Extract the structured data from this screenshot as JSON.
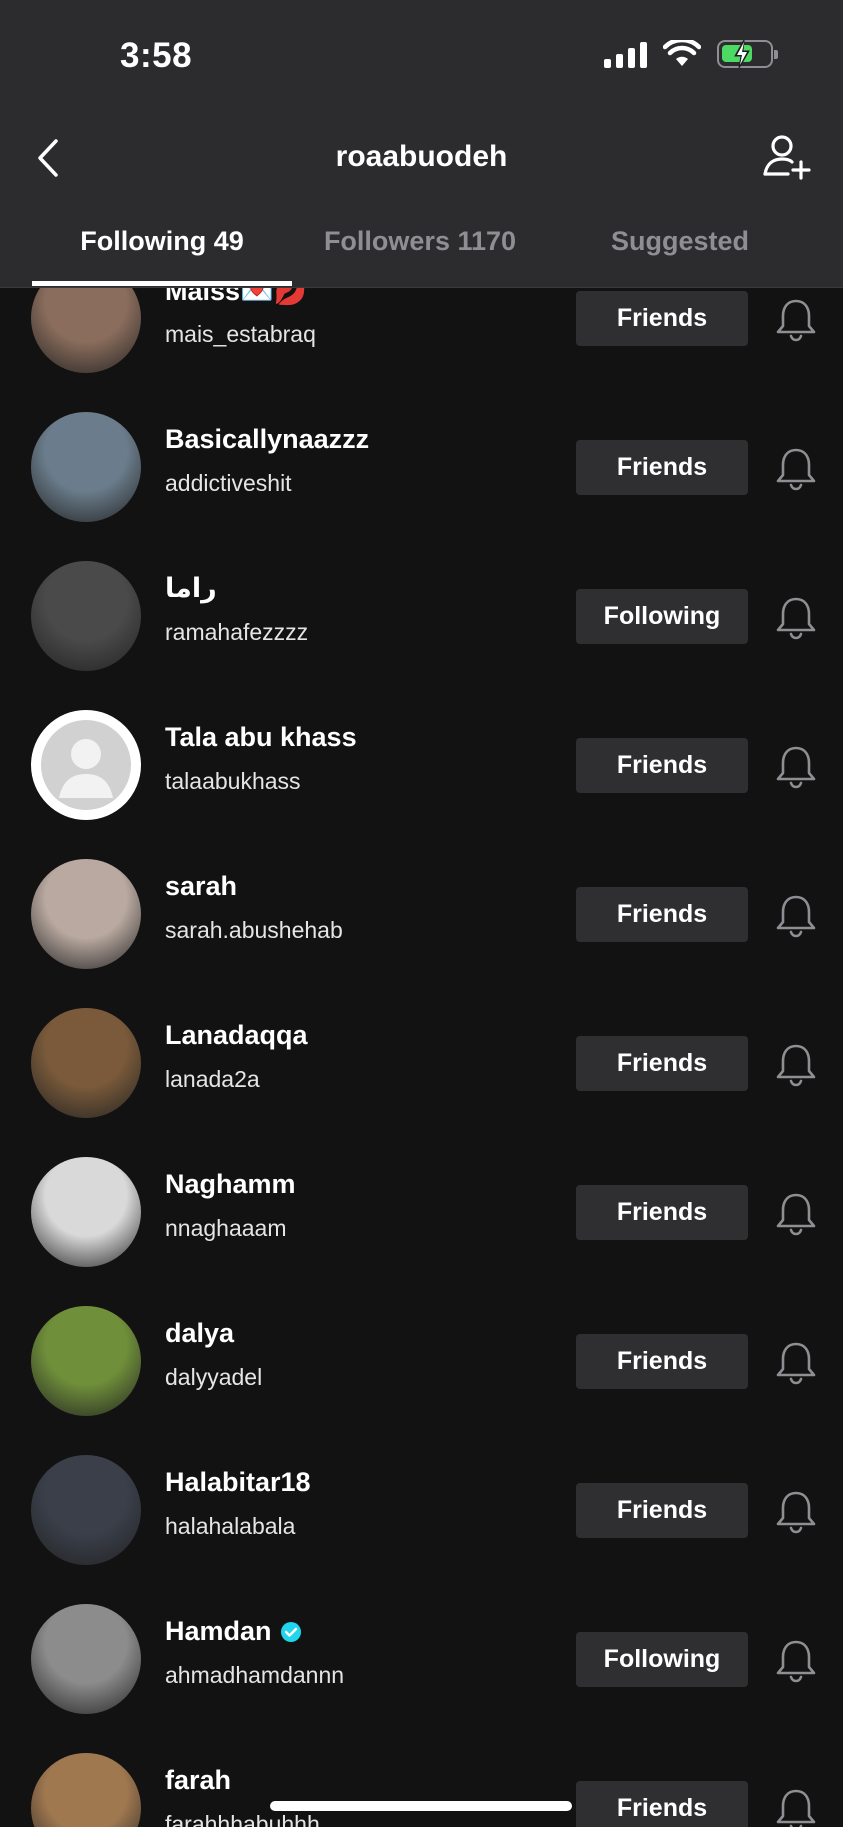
{
  "status_bar": {
    "time": "3:58"
  },
  "header": {
    "title": "roaabuodeh"
  },
  "tabs": [
    {
      "label": "Following 49",
      "active": true
    },
    {
      "label": "Followers 1170",
      "active": false
    },
    {
      "label": "Suggested",
      "active": false
    }
  ],
  "users": [
    {
      "name": "Maiss💌💋",
      "handle": "mais_estabraq",
      "action": "Friends",
      "verified": false,
      "avatar_color": "#8a6d5c"
    },
    {
      "name": "Basicallynaazzz",
      "handle": "addictiveshit",
      "action": "Friends",
      "verified": false,
      "avatar_color": "#6b7d8c"
    },
    {
      "name": "راما",
      "handle": "ramahafezzzz",
      "action": "Following",
      "verified": false,
      "avatar_color": "#4a4a4a"
    },
    {
      "name": "Tala abu khass",
      "handle": "talaabukhass",
      "action": "Friends",
      "verified": false,
      "avatar_color": "#cfcfcf"
    },
    {
      "name": "sarah",
      "handle": "sarah.abushehab",
      "action": "Friends",
      "verified": false,
      "avatar_color": "#b9a9a0"
    },
    {
      "name": "Lanadaqqa",
      "handle": "lanada2a",
      "action": "Friends",
      "verified": false,
      "avatar_color": "#7a5a3a"
    },
    {
      "name": "Naghamm",
      "handle": "nnaghaaam",
      "action": "Friends",
      "verified": false,
      "avatar_color": "#d9d9d9"
    },
    {
      "name": "dalya",
      "handle": "dalyyadel",
      "action": "Friends",
      "verified": false,
      "avatar_color": "#6f8f3a"
    },
    {
      "name": "Halabitar18",
      "handle": "halahalabala",
      "action": "Friends",
      "verified": false,
      "avatar_color": "#3a3f4a"
    },
    {
      "name": "Hamdan",
      "handle": "ahmadhamdannn",
      "action": "Following",
      "verified": true,
      "avatar_color": "#8c8c8c"
    },
    {
      "name": "farah",
      "handle": "farahhhabuhhh",
      "action": "Friends",
      "verified": false,
      "avatar_color": "#a07850"
    }
  ],
  "colors": {
    "accent_verified": "#20d5ec",
    "button_bg": "#2f2f31"
  }
}
